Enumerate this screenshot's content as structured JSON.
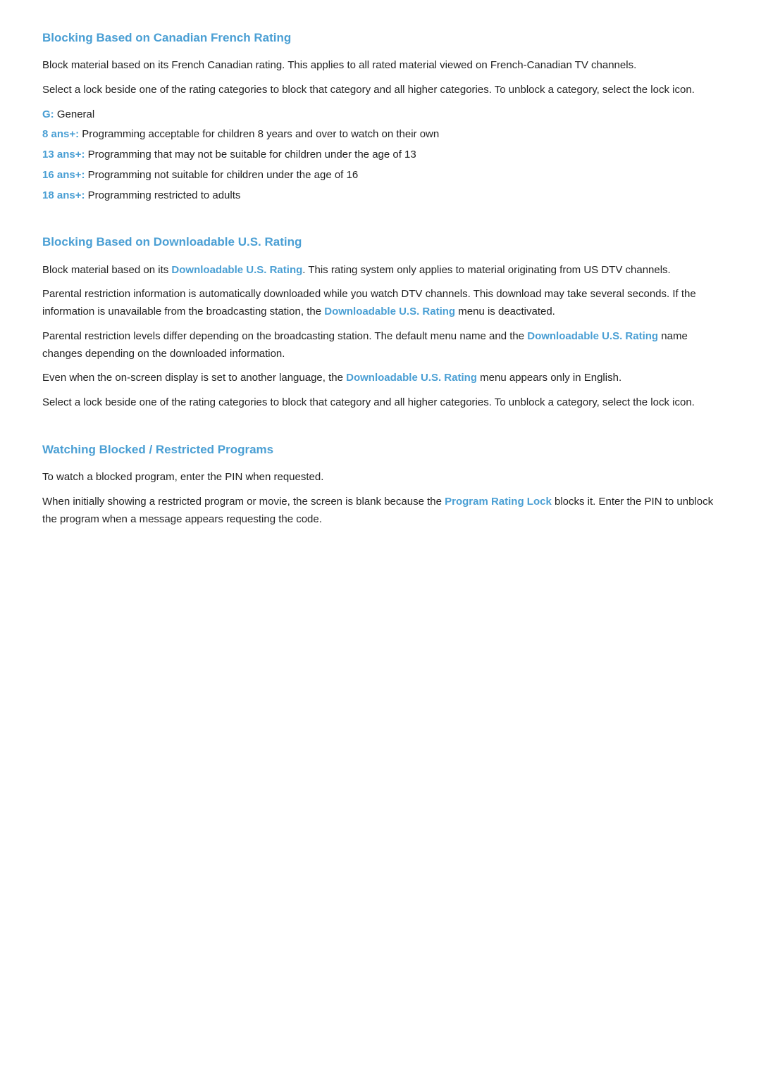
{
  "sections": [
    {
      "id": "canadian-french-rating",
      "title": "Blocking Based on Canadian French Rating",
      "paragraphs": [
        "Block material based on its French Canadian rating. This applies to all rated material viewed on French-Canadian TV channels.",
        "Select a lock beside one of the rating categories to block that category and all higher categories. To unblock a category, select the lock icon."
      ],
      "ratings": [
        {
          "label": "G:",
          "description": "General"
        },
        {
          "label": "8 ans+:",
          "description": "Programming acceptable for children 8 years and over to watch on their own"
        },
        {
          "label": "13 ans+:",
          "description": "Programming that may not be suitable for children under the age of 13"
        },
        {
          "label": "16 ans+:",
          "description": "Programming not suitable for children under the age of 16"
        },
        {
          "label": "18 ans+:",
          "description": "Programming restricted to adults"
        }
      ]
    },
    {
      "id": "downloadable-us-rating",
      "title": "Blocking Based on Downloadable U.S. Rating",
      "paragraphs": [
        {
          "parts": [
            {
              "text": "Block material based on its ",
              "type": "normal"
            },
            {
              "text": "Downloadable U.S. Rating",
              "type": "link"
            },
            {
              "text": ". This rating system only applies to material originating from US DTV channels.",
              "type": "normal"
            }
          ]
        },
        {
          "parts": [
            {
              "text": "Parental restriction information is automatically downloaded while you watch DTV channels. This download may take several seconds. If the information is unavailable from the broadcasting station, the ",
              "type": "normal"
            },
            {
              "text": "Downloadable U.S. Rating",
              "type": "link"
            },
            {
              "text": " menu is deactivated.",
              "type": "normal"
            }
          ]
        },
        {
          "parts": [
            {
              "text": "Parental restriction levels differ depending on the broadcasting station. The default menu name and the ",
              "type": "normal"
            },
            {
              "text": "Downloadable U.S. Rating",
              "type": "link"
            },
            {
              "text": " name changes depending on the downloaded information.",
              "type": "normal"
            }
          ]
        },
        {
          "parts": [
            {
              "text": "Even when the on-screen display is set to another language, the ",
              "type": "normal"
            },
            {
              "text": "Downloadable U.S. Rating",
              "type": "link"
            },
            {
              "text": " menu appears only in English.",
              "type": "normal"
            }
          ]
        },
        {
          "parts": [
            {
              "text": "Select a lock beside one of the rating categories to block that category and all higher categories. To unblock a category, select the lock icon.",
              "type": "normal"
            }
          ]
        }
      ]
    },
    {
      "id": "watching-blocked-restricted",
      "title": "Watching Blocked / Restricted Programs",
      "paragraphs": [
        {
          "parts": [
            {
              "text": "To watch a blocked program, enter the PIN when requested.",
              "type": "normal"
            }
          ]
        },
        {
          "parts": [
            {
              "text": "When initially showing a restricted program or movie, the screen is blank because the ",
              "type": "normal"
            },
            {
              "text": "Program Rating Lock",
              "type": "link"
            },
            {
              "text": " blocks it. Enter the PIN to unblock the program when a message appears requesting the code.",
              "type": "normal"
            }
          ]
        }
      ]
    }
  ]
}
